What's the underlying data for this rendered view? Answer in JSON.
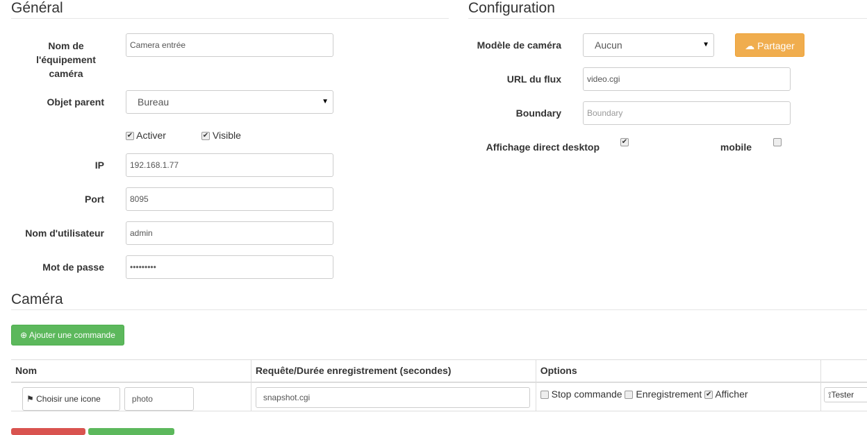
{
  "general": {
    "title": "Général",
    "name_label": "Nom de l'équipement caméra",
    "name_value": "Camera entrée",
    "parent_label": "Objet parent",
    "parent_value": "Bureau",
    "activate_label": "Activer",
    "activate_checked": true,
    "visible_label": "Visible",
    "visible_checked": true,
    "ip_label": "IP",
    "ip_value": "192.168.1.77",
    "port_label": "Port",
    "port_value": "8095",
    "user_label": "Nom d'utilisateur",
    "user_value": "admin",
    "password_label": "Mot de passe",
    "password_value": "•••••••••"
  },
  "config": {
    "title": "Configuration",
    "model_label": "Modèle de caméra",
    "model_value": "Aucun",
    "share_label": "Partager",
    "url_label": "URL du flux",
    "url_value": "video.cgi",
    "boundary_label": "Boundary",
    "boundary_placeholder": "Boundary",
    "desktop_label": "Affichage direct desktop",
    "desktop_checked": true,
    "mobile_label": "mobile",
    "mobile_checked": false
  },
  "camera": {
    "title": "Caméra",
    "add_command_label": "Ajouter une commande",
    "table": {
      "headers": [
        "Nom",
        "Requête/Durée enregistrement (secondes)",
        "Options",
        ""
      ],
      "rows": [
        {
          "icon_button": "Choisir une icone",
          "name": "photo",
          "request": "snapshot.cgi",
          "opt_stop": "Stop commande",
          "opt_stop_checked": false,
          "opt_record": "Enregistrement",
          "opt_record_checked": false,
          "opt_show": "Afficher",
          "opt_show_checked": true,
          "test_label": "Tester"
        }
      ]
    }
  },
  "colors": {
    "success": "#5cb85c",
    "warning": "#f0ad4e",
    "danger": "#d9534f"
  }
}
